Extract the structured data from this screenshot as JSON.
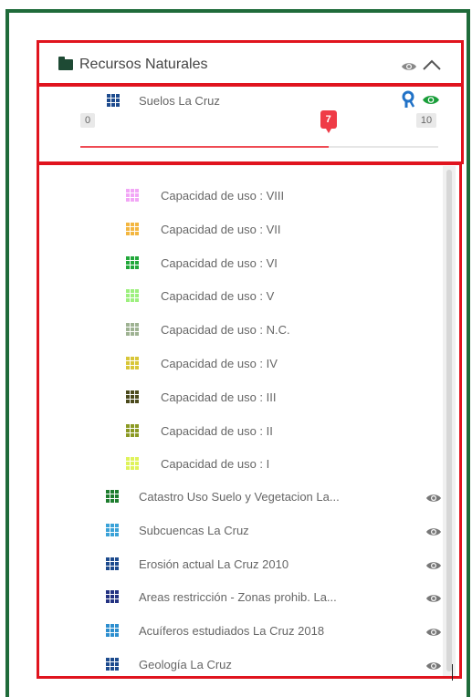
{
  "panel": {
    "header": {
      "title": "Recursos Naturales"
    },
    "active_layer": {
      "name": "Suelos La Cruz",
      "slider": {
        "min_label": "0",
        "max_label": "10",
        "value_label": "7",
        "value": 7,
        "max": 10
      }
    },
    "legend": [
      {
        "label": "Capacidad de uso : VIII",
        "color": "#f2a6f6"
      },
      {
        "label": "Capacidad de uso : VII",
        "color": "#f3b640"
      },
      {
        "label": "Capacidad de uso : VI",
        "color": "#21a83a"
      },
      {
        "label": "Capacidad de uso : V",
        "color": "#9df07e"
      },
      {
        "label": "Capacidad de uso : N.C.",
        "color": "#9eb292"
      },
      {
        "label": "Capacidad de uso : IV",
        "color": "#d8c638"
      },
      {
        "label": "Capacidad de uso : III",
        "color": "#4b4a1c"
      },
      {
        "label": "Capacidad de uso : II",
        "color": "#8b9a23"
      },
      {
        "label": "Capacidad de uso : I",
        "color": "#dff35a"
      }
    ],
    "layers": [
      {
        "label": "Catastro Uso Suelo y Vegetacion La...",
        "color": "#1d7d2e"
      },
      {
        "label": "Subcuencas La Cruz",
        "color": "#3aa2d8"
      },
      {
        "label": "Erosión actual La Cruz 2010",
        "color": "#1d4b8e"
      },
      {
        "label": "Areas restricción - Zonas prohib. La...",
        "color": "#233282"
      },
      {
        "label": "Acuíferos estudiados La Cruz 2018",
        "color": "#2c8ecf"
      },
      {
        "label": "Geología La Cruz",
        "color": "#1d4b8e"
      }
    ],
    "icons": {
      "header_eye": "eye-icon",
      "collapse": "chevron-up-icon",
      "query": "query-pin-icon",
      "active_eye": "eye-icon"
    },
    "colors": {
      "accent_green": "#1f6b3a",
      "highlight_red": "#e0141e",
      "slider_red": "#ef3b47",
      "active_eye_green": "#1a9e3a",
      "query_blue": "#2172c7"
    }
  }
}
